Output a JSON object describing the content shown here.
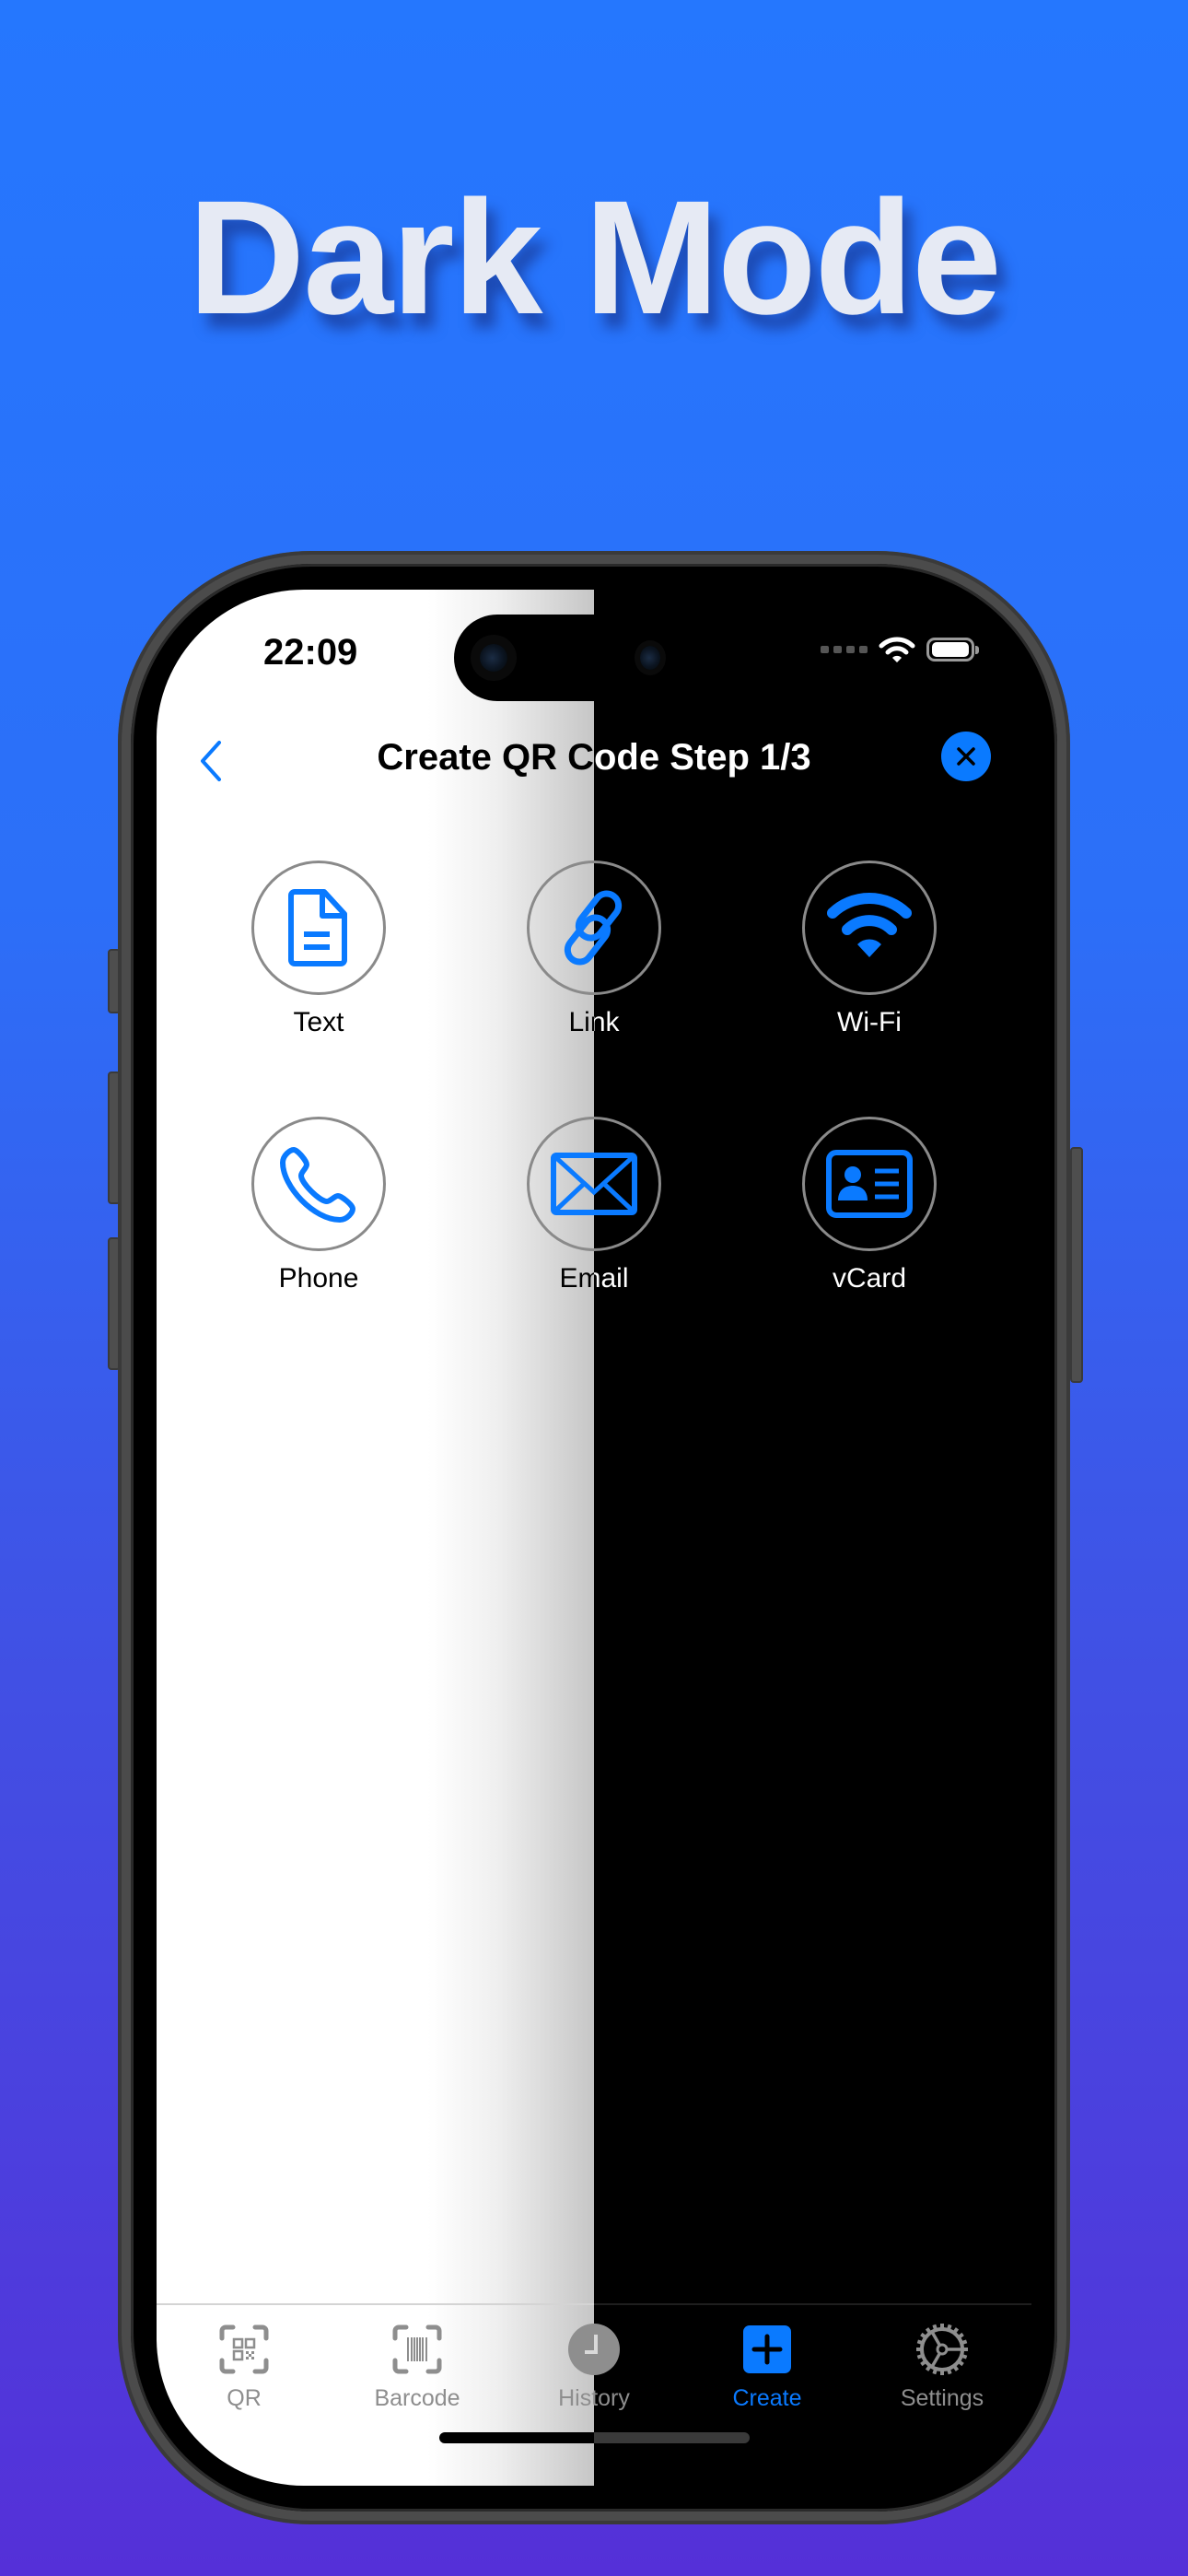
{
  "headline": "Dark Mode",
  "colors": {
    "accent": "#0A7AFF",
    "background_top": "#2577FE",
    "background_bottom": "#5530D8",
    "tab_inactive": "#8E8E8E",
    "headline_text": "#E6EAF4"
  },
  "status_bar": {
    "time": "22:09",
    "icons": [
      "cellular-signal-icon",
      "wifi-icon",
      "battery-icon"
    ]
  },
  "nav": {
    "back_icon": "chevron-left-icon",
    "title": "Create QR Code Step 1/3",
    "close_icon": "close-icon"
  },
  "types": [
    {
      "label": "Text",
      "icon": "document-icon"
    },
    {
      "label": "Link",
      "icon": "link-icon"
    },
    {
      "label": "Wi-Fi",
      "icon": "wifi-icon"
    },
    {
      "label": "Phone",
      "icon": "phone-icon"
    },
    {
      "label": "Email",
      "icon": "envelope-icon"
    },
    {
      "label": "vCard",
      "icon": "contact-card-icon"
    }
  ],
  "tabs": [
    {
      "label": "QR",
      "icon": "qr-scan-icon",
      "active": false
    },
    {
      "label": "Barcode",
      "icon": "barcode-scan-icon",
      "active": false
    },
    {
      "label": "History",
      "icon": "clock-icon",
      "active": false
    },
    {
      "label": "Create",
      "icon": "plus-square-icon",
      "active": true
    },
    {
      "label": "Settings",
      "icon": "gear-icon",
      "active": false
    }
  ]
}
